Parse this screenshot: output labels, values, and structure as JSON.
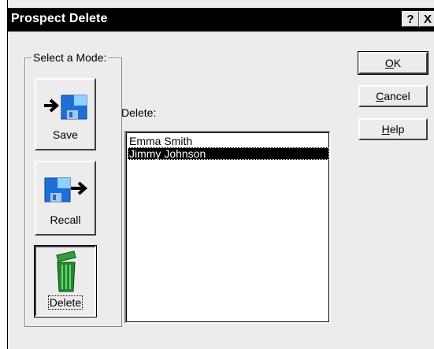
{
  "window": {
    "title": "Prospect Delete",
    "help_btn": "?",
    "close_btn": "X"
  },
  "mode_group": {
    "label": "Select a Mode:",
    "buttons": [
      {
        "label": "Save",
        "icon": "disk-with-arrow-in-icon"
      },
      {
        "label": "Recall",
        "icon": "disk-with-arrow-out-icon"
      },
      {
        "label": "Delete",
        "icon": "trash-can-icon",
        "pressed": true
      }
    ]
  },
  "delete_list": {
    "label": "Delete:",
    "items": [
      "Emma Smith",
      "Jimmy Johnson"
    ],
    "selected": "Jimmy Johnson"
  },
  "commands": {
    "ok": {
      "accel": "O",
      "rest": "K"
    },
    "cancel": {
      "accel": "C",
      "rest": "ancel"
    },
    "help": {
      "accel": "H",
      "rest": "elp"
    }
  },
  "colors": {
    "titlebar": "#000000",
    "dialog_bg": "#ececec",
    "disk_blue": "#1f6fd8",
    "trash_green": "#1f8a2a"
  }
}
